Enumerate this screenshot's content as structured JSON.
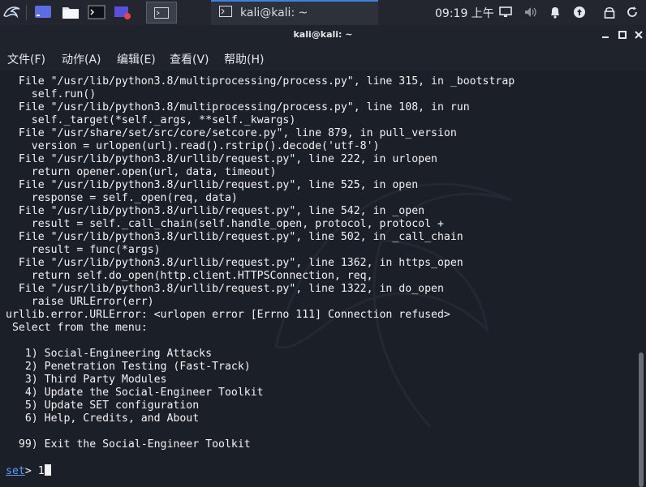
{
  "panel": {
    "task_title": "kali@kali: ~",
    "clock": "09:19 上午"
  },
  "window": {
    "title": "kali@kali: ~"
  },
  "menubar": {
    "file": "文件(F)",
    "action": "动作(A)",
    "edit": "编辑(E)",
    "view": "查看(V)",
    "help": "帮助(H)"
  },
  "terminal": {
    "lines": [
      "  File \"/usr/lib/python3.8/multiprocessing/process.py\", line 315, in _bootstrap",
      "    self.run()",
      "  File \"/usr/lib/python3.8/multiprocessing/process.py\", line 108, in run",
      "    self._target(*self._args, **self._kwargs)",
      "  File \"/usr/share/set/src/core/setcore.py\", line 879, in pull_version",
      "    version = urlopen(url).read().rstrip().decode('utf-8')",
      "  File \"/usr/lib/python3.8/urllib/request.py\", line 222, in urlopen",
      "    return opener.open(url, data, timeout)",
      "  File \"/usr/lib/python3.8/urllib/request.py\", line 525, in open",
      "    response = self._open(req, data)",
      "  File \"/usr/lib/python3.8/urllib/request.py\", line 542, in _open",
      "    result = self._call_chain(self.handle_open, protocol, protocol +",
      "  File \"/usr/lib/python3.8/urllib/request.py\", line 502, in _call_chain",
      "    result = func(*args)",
      "  File \"/usr/lib/python3.8/urllib/request.py\", line 1362, in https_open",
      "    return self.do_open(http.client.HTTPSConnection, req,",
      "  File \"/usr/lib/python3.8/urllib/request.py\", line 1322, in do_open",
      "    raise URLError(err)",
      "urllib.error.URLError: <urlopen error [Errno 111] Connection refused>",
      " Select from the menu:",
      "",
      "   1) Social-Engineering Attacks",
      "   2) Penetration Testing (Fast-Track)",
      "   3) Third Party Modules",
      "   4) Update the Social-Engineer Toolkit",
      "   5) Update SET configuration",
      "   6) Help, Credits, and About",
      "",
      "  99) Exit the Social-Engineer Toolkit",
      ""
    ],
    "prompt": "set",
    "prompt_suffix": "> ",
    "input": "1"
  },
  "colors": {
    "terminal_bg": "#1b1f28",
    "panel_bg": "#23262e",
    "text": "#f2f2f2",
    "prompt": "#5f9cff",
    "accent": "#3f7fdf"
  },
  "icons": {
    "launcher": "kali-dragon-icon",
    "desktop": "show-desktop-icon",
    "files": "file-manager-icon",
    "terminal": "terminal-icon",
    "recorder": "screen-recorder-icon",
    "tray": [
      "display-icon",
      "volume-icon",
      "notification-bell-icon",
      "update-arrow-icon",
      "lock-icon",
      "refresh-icon"
    ]
  }
}
